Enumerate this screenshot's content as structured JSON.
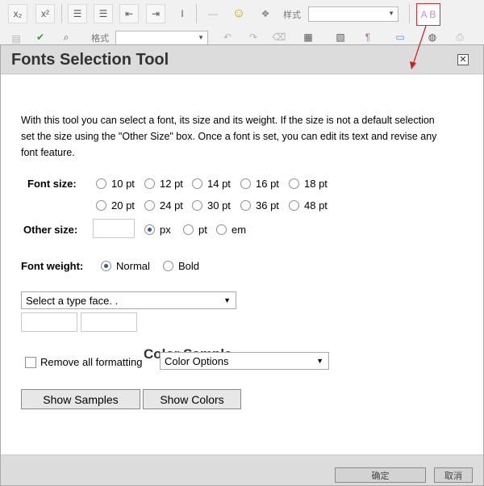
{
  "toolbar": {
    "buttons_row1": [
      {
        "name": "subscript-icon",
        "glyph": "x₂"
      },
      {
        "name": "superscript-icon",
        "glyph": "x²"
      },
      {
        "name": "ordered-list-icon",
        "glyph": "☰"
      },
      {
        "name": "unordered-list-icon",
        "glyph": "☰"
      },
      {
        "name": "outdent-icon",
        "glyph": "⇤"
      },
      {
        "name": "indent-icon",
        "glyph": "⇥"
      },
      {
        "name": "text-direction-icon",
        "glyph": "I"
      },
      {
        "name": "horizontal-rule-icon",
        "glyph": "—"
      },
      {
        "name": "smiley-icon",
        "glyph": "☺"
      },
      {
        "name": "special-char-icon",
        "glyph": "❖"
      }
    ],
    "style_label": "样式",
    "style_value": "",
    "fonts_button_glyph": "A B",
    "buttons_row2": [
      {
        "name": "paste-icon",
        "glyph": "▤"
      },
      {
        "name": "spellcheck-icon",
        "glyph": "✔"
      },
      {
        "name": "find-icon",
        "glyph": "⌕"
      }
    ],
    "format_label": "格式",
    "format_value": "",
    "buttons_row2b": [
      {
        "name": "undo-icon",
        "glyph": "↶"
      },
      {
        "name": "redo-icon",
        "glyph": "↷"
      },
      {
        "name": "eraser-icon",
        "glyph": "⌫"
      },
      {
        "name": "table-icon",
        "glyph": "▦"
      },
      {
        "name": "image-icon",
        "glyph": "▧"
      },
      {
        "name": "paragraph-icon",
        "glyph": "¶"
      },
      {
        "name": "preview-icon",
        "glyph": "▭"
      },
      {
        "name": "globe-icon",
        "glyph": "◍"
      },
      {
        "name": "print-icon",
        "glyph": "⎙"
      }
    ]
  },
  "dialog": {
    "title": "Fonts Selection Tool",
    "close_glyph": "✕",
    "intro": "With this tool you can select a font, its size and its weight. If the size is not a default selection set the size using the \"Other Size\" box. Once a font is set, you can edit its text and revise any font feature.",
    "font_size_label": "Font size:",
    "sizes_row1": [
      "10 pt",
      "12 pt",
      "14 pt",
      "16 pt",
      "18 pt"
    ],
    "sizes_row2": [
      "20 pt",
      "24 pt",
      "30 pt",
      "36 pt",
      "48 pt"
    ],
    "other_size_label": "Other size:",
    "other_size_value": "",
    "units": [
      {
        "label": "px",
        "checked": true
      },
      {
        "label": "pt",
        "checked": false
      },
      {
        "label": "em",
        "checked": false
      }
    ],
    "font_weight_label": "Font weight:",
    "weights": [
      {
        "label": "Normal",
        "checked": true
      },
      {
        "label": "Bold",
        "checked": false
      }
    ],
    "typeface_value": "Select a type face. .",
    "color_field_1": "",
    "color_field_2": "",
    "color_sample": "Color Sample",
    "remove_formatting_label": "Remove all formatting",
    "remove_formatting_checked": false,
    "color_options_value": "Color Options",
    "show_samples_label": "Show Samples",
    "show_colors_label": "Show Colors",
    "ok_label": "确定",
    "cancel_label": "取消"
  },
  "colors": {
    "fonts_button_border": "#d83030",
    "arrow": "#d02020",
    "radio_selected": "#3057a8"
  }
}
